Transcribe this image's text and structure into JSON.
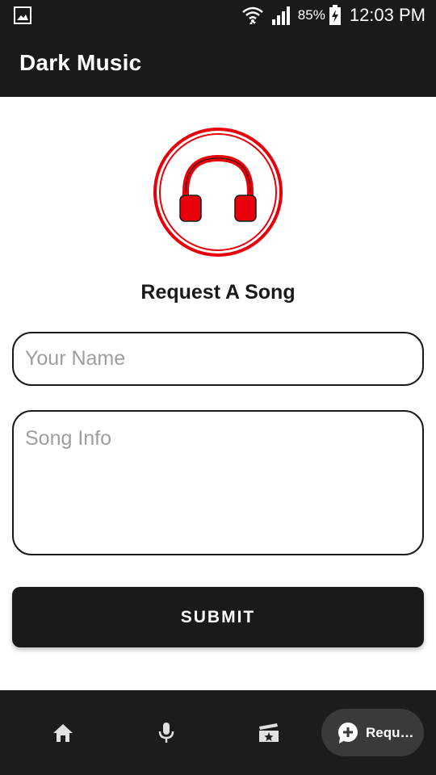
{
  "status_bar": {
    "battery_percent": "85%",
    "time": "12:03 PM",
    "icons": [
      "gallery-icon",
      "wifi-icon",
      "signal-icon",
      "battery-charging-icon"
    ]
  },
  "app_bar": {
    "title": "Dark Music"
  },
  "logo": {
    "icon": "headphones-icon",
    "accent_color": "#e8000a"
  },
  "form": {
    "title": "Request A Song",
    "name_placeholder": "Your Name",
    "name_value": "",
    "song_placeholder": "Song Info",
    "song_value": "",
    "submit_label": "SUBMIT"
  },
  "bottom_nav": {
    "items": [
      {
        "icon": "home-icon",
        "label": ""
      },
      {
        "icon": "microphone-icon",
        "label": ""
      },
      {
        "icon": "movie-icon",
        "label": ""
      },
      {
        "icon": "add-comment-icon",
        "label": "Reque…",
        "selected": true
      }
    ]
  },
  "colors": {
    "dark": "#1a1a1a",
    "nav_selected_bg": "#3a3a3a",
    "placeholder": "#9e9e9e"
  }
}
